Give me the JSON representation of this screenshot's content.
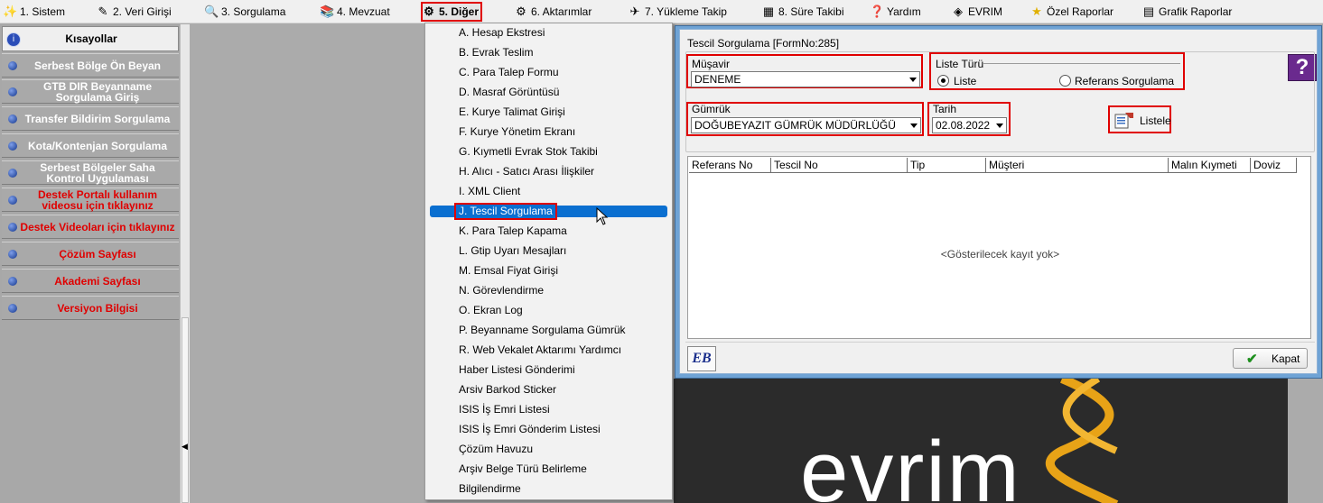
{
  "menubar": {
    "items": [
      {
        "label": "1.  Sistem",
        "icon": "wand-icon"
      },
      {
        "label": "2.  Veri Girişi",
        "icon": "edit-icon"
      },
      {
        "label": "3.  Sorgulama",
        "icon": "query-icon"
      },
      {
        "label": "4.  Mevzuat",
        "icon": "books-icon"
      },
      {
        "label": "5.  Diğer",
        "icon": "other-icon"
      },
      {
        "label": "6.  Aktarımlar",
        "icon": "transfer-icon"
      },
      {
        "label": "7.  Yükleme Takip",
        "icon": "tracking-icon"
      },
      {
        "label": "8. Süre Takibi",
        "icon": "calendar-icon"
      },
      {
        "label": "Yardım",
        "icon": "help-icon"
      },
      {
        "label": "EVRIM",
        "icon": "evrim-icon"
      },
      {
        "label": "Özel Raporlar",
        "icon": "star-icon"
      },
      {
        "label": "Grafik Raporlar",
        "icon": "chart-icon"
      }
    ]
  },
  "sidebar": {
    "title": "Kısayollar",
    "items": [
      {
        "label": "Serbest Bölge Ön Beyan",
        "color": "#ffffff"
      },
      {
        "label": "GTB DIR Beyanname Sorgulama Giriş",
        "color": "#ffffff"
      },
      {
        "label": "Transfer Bildirim Sorgulama",
        "color": "#ffffff"
      },
      {
        "label": "Kota/Kontenjan Sorgulama",
        "color": "#ffffff"
      },
      {
        "label": "Serbest Bölgeler Saha Kontrol Uygulaması",
        "color": "#ffffff"
      },
      {
        "label": "Destek Portalı kullanım videosu için tıklayınız",
        "color": "#e00000"
      },
      {
        "label": "Destek Videoları için tıklayınız",
        "color": "#e00000"
      },
      {
        "label": "Çözüm Sayfası",
        "color": "#e00000"
      },
      {
        "label": "Akademi Sayfası",
        "color": "#e00000"
      },
      {
        "label": "Versiyon Bilgisi",
        "color": "#e00000"
      }
    ]
  },
  "dropdown": {
    "items": [
      "A. Hesap Ekstresi",
      "B. Evrak Teslim",
      "C. Para Talep Formu",
      "D. Masraf Görüntüsü",
      "E. Kurye Talimat Girişi",
      "F. Kurye Yönetim Ekranı",
      "G. Kıymetli Evrak Stok Takibi",
      "H. Alıcı - Satıcı Arası İlişkiler",
      "I. XML Client",
      "J. Tescil Sorgulama",
      "K. Para Talep Kapama",
      "L. Gtip Uyarı Mesajları",
      "M. Emsal Fiyat Girişi",
      "N. Görevlendirme",
      "O. Ekran Log",
      "P. Beyanname Sorgulama Gümrük",
      "R. Web Vekalet Aktarımı Yardımcı",
      "Haber Listesi Gönderimi",
      "Arsiv Barkod Sticker",
      "ISIS İş Emri Listesi",
      "ISIS İş Emri Gönderim Listesi",
      "Çözüm Havuzu",
      "Arşiv Belge Türü Belirleme",
      "Bilgilendirme"
    ],
    "selected": "J. Tescil Sorgulama"
  },
  "dialog": {
    "title": "Tescil Sorgulama [FormNo:285]",
    "help_label": "?",
    "musavir": {
      "label": "Müşavir",
      "value": "DENEME"
    },
    "liste_turu": {
      "label": "Liste Türü",
      "option1": "Liste",
      "option2": "Referans Sorgulama",
      "selected": "Liste"
    },
    "gumruk": {
      "label": "Gümrük",
      "value": "DOĞUBEYAZIT GÜMRÜK MÜDÜRLÜĞÜ"
    },
    "tarih": {
      "label": "Tarih",
      "value": "02.08.2022"
    },
    "listele_label": "Listele",
    "columns": [
      "Referans No",
      "Tescil No",
      "Tip",
      "Müşteri",
      "Malın Kıymeti",
      "Doviz"
    ],
    "empty_message": "<Gösterilecek kayıt yok>",
    "eb_label": "EB",
    "kapat_label": "Kapat"
  },
  "logo": {
    "text": "evrim"
  },
  "colors": {
    "accent_red": "#e00000",
    "menu_highlight": "#0a6fd0",
    "dialog_border": "#6fa3d5"
  }
}
